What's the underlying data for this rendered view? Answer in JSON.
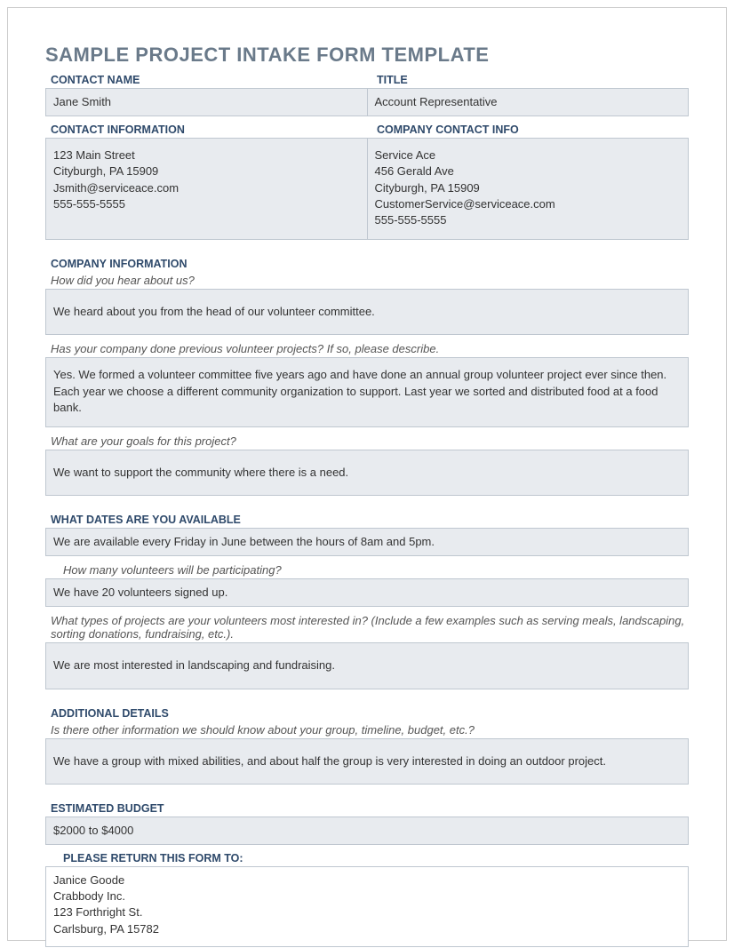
{
  "title": "SAMPLE PROJECT INTAKE FORM TEMPLATE",
  "contact": {
    "name_label": "CONTACT NAME",
    "name_value": "Jane Smith",
    "title_label": "TITLE",
    "title_value": "Account Representative",
    "info_label": "CONTACT INFORMATION",
    "info_value": "123 Main Street\nCityburgh, PA 15909\nJsmith@serviceace.com\n555-555-5555",
    "company_label": "COMPANY CONTACT INFO",
    "company_value": "Service Ace\n456 Gerald Ave\nCityburgh, PA 15909\nCustomerService@serviceace.com\n555-555-5555"
  },
  "company_info": {
    "header": "COMPANY INFORMATION",
    "q1": "How did you hear about us?",
    "a1": "We heard about you from the head of our volunteer committee.",
    "q2": "Has your company done previous volunteer projects? If so, please describe.",
    "a2": "Yes. We formed a volunteer committee five years ago and have done an annual group volunteer project ever since then. Each year we choose a different community organization to support. Last year we sorted and distributed food at a food bank.",
    "q3": "What are your goals for this project?",
    "a3": "We want to support the community where there is a need."
  },
  "dates": {
    "header": "WHAT DATES ARE YOU AVAILABLE",
    "a1": "We are available every Friday in June between the hours of 8am and 5pm.",
    "q2": "How many volunteers will be participating?",
    "a2": "We have 20 volunteers signed up.",
    "q3": "What types of projects are your volunteers most interested in? (Include a few examples such as serving meals, landscaping, sorting donations, fundraising, etc.).",
    "a3": "We are most interested in landscaping and fundraising."
  },
  "additional": {
    "header": "ADDITIONAL DETAILS",
    "q1": "Is there other information we should know about your group, timeline, budget, etc.?",
    "a1": "We have a group with mixed abilities, and about half the group is very interested in doing an outdoor project."
  },
  "budget": {
    "header": "ESTIMATED BUDGET",
    "value": "$2000 to $4000"
  },
  "return": {
    "header": "PLEASE RETURN THIS FORM TO:",
    "value": "Janice Goode\nCrabbody Inc.\n123 Forthright St.\nCarlsburg, PA 15782"
  }
}
